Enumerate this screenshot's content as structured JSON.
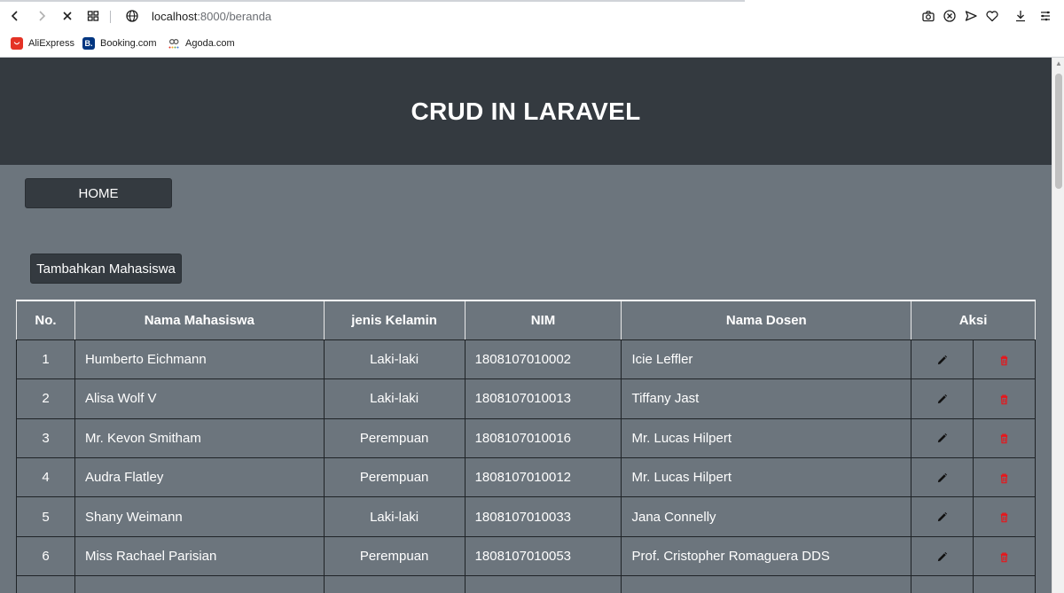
{
  "browser": {
    "url_host": "localhost",
    "url_path": ":8000/beranda",
    "bookmarks": [
      {
        "label": "AliExpress",
        "color": "#e43225"
      },
      {
        "label": "Booking.com",
        "color": "#003580"
      },
      {
        "label": "Agoda.com",
        "color": "#ffffff"
      }
    ]
  },
  "hero": {
    "title": "CRUD IN LARAVEL"
  },
  "nav": {
    "home_label": "HOME"
  },
  "actions": {
    "add_label": "Tambahkan Mahasiswa"
  },
  "table": {
    "headers": [
      "No.",
      "Nama Mahasiswa",
      "jenis Kelamin",
      "NIM",
      "Nama Dosen",
      "Aksi"
    ],
    "rows": [
      {
        "no": "1",
        "nama": "Humberto Eichmann",
        "jk": "Laki-laki",
        "nim": "1808107010002",
        "dosen": "Icie Leffler"
      },
      {
        "no": "2",
        "nama": "Alisa Wolf V",
        "jk": "Laki-laki",
        "nim": "1808107010013",
        "dosen": "Tiffany Jast"
      },
      {
        "no": "3",
        "nama": "Mr. Kevon Smitham",
        "jk": "Perempuan",
        "nim": "1808107010016",
        "dosen": "Mr. Lucas Hilpert"
      },
      {
        "no": "4",
        "nama": "Audra Flatley",
        "jk": "Perempuan",
        "nim": "1808107010012",
        "dosen": "Mr. Lucas Hilpert"
      },
      {
        "no": "5",
        "nama": "Shany Weimann",
        "jk": "Laki-laki",
        "nim": "1808107010033",
        "dosen": "Jana Connelly"
      },
      {
        "no": "6",
        "nama": "Miss Rachael Parisian",
        "jk": "Perempuan",
        "nim": "1808107010053",
        "dosen": "Prof. Cristopher Romaguera DDS"
      }
    ],
    "edit_icon": "pencil-icon",
    "delete_icon": "trash-icon",
    "delete_color": "#e8161b"
  }
}
